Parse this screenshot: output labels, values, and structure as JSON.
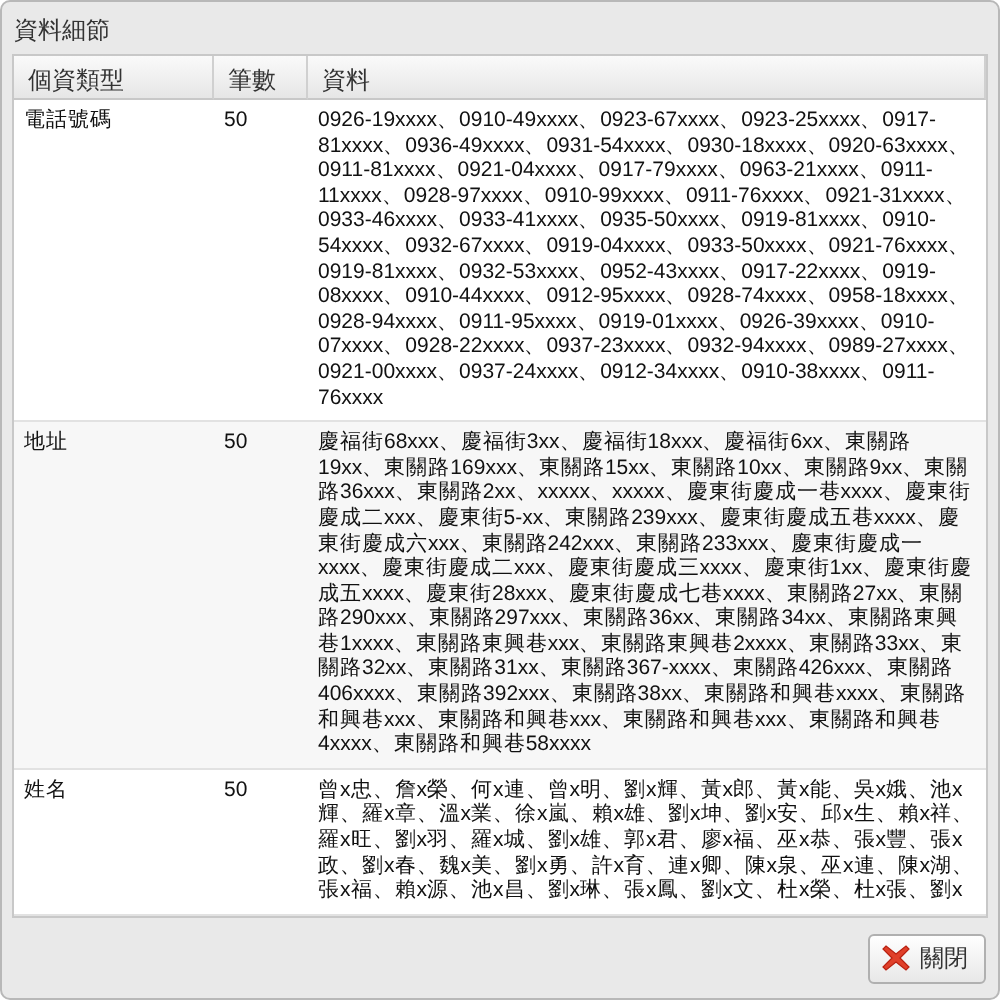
{
  "window": {
    "title": "資料細節"
  },
  "table": {
    "columns": [
      "個資類型",
      "筆數",
      "資料"
    ],
    "rows": [
      {
        "type": "電話號碼",
        "count": "50",
        "data": "0926-19xxxx、0910-49xxxx、0923-67xxxx、0923-25xxxx、0917-81xxxx、0936-49xxxx、0931-54xxxx、0930-18xxxx、0920-63xxxx、0911-81xxxx、0921-04xxxx、0917-79xxxx、0963-21xxxx、0911-11xxxx、0928-97xxxx、0910-99xxxx、0911-76xxxx、0921-31xxxx、0933-46xxxx、0933-41xxxx、0935-50xxxx、0919-81xxxx、0910-54xxxx、0932-67xxxx、0919-04xxxx、0933-50xxxx、0921-76xxxx、0919-81xxxx、0932-53xxxx、0952-43xxxx、0917-22xxxx、0919-08xxxx、0910-44xxxx、0912-95xxxx、0928-74xxxx、0958-18xxxx、0928-94xxxx、0911-95xxxx、0919-01xxxx、0926-39xxxx、0910-07xxxx、0928-22xxxx、0937-23xxxx、0932-94xxxx、0989-27xxxx、0921-00xxxx、0937-24xxxx、0912-34xxxx、0910-38xxxx、0911-76xxxx"
      },
      {
        "type": "地址",
        "count": "50",
        "data": "慶福街68xxx、慶福街3xx、慶福街18xxx、慶福街6xx、東關路19xx、東關路169xxx、東關路15xx、東關路10xx、東關路9xx、東關路36xxx、東關路2xx、xxxxx、xxxxx、慶東街慶成一巷xxxx、慶東街慶成二xxx、慶東街5-xx、東關路239xxx、慶東街慶成五巷xxxx、慶東街慶成六xxx、東關路242xxx、東關路233xxx、慶東街慶成一xxxx、慶東街慶成二xxx、慶東街慶成三xxxx、慶東街1xx、慶東街慶成五xxxx、慶東街28xxx、慶東街慶成七巷xxxx、東關路27xx、東關路290xxx、東關路297xxx、東關路36xx、東關路34xx、東關路東興巷1xxxx、東關路東興巷xxx、東關路東興巷2xxxx、東關路33xx、東關路32xx、東關路31xx、東關路367-xxxx、東關路426xxx、東關路406xxxx、東關路392xxx、東關路38xx、東關路和興巷xxxx、東關路和興巷xxx、東關路和興巷xxx、東關路和興巷xxx、東關路和興巷4xxxx、東關路和興巷58xxxx"
      },
      {
        "type": "姓名",
        "count": "50",
        "data": "曾x忠、詹x榮、何x連、曾x明、劉x輝、黃x郎、黃x能、吳x娥、池x輝、羅x章、溫x業、徐x嵐、賴x雄、劉x坤、劉x安、邱x生、賴x祥、羅x旺、劉x羽、羅x城、劉x雄、郭x君、廖x福、巫x恭、張x豐、張x政、劉x春、魏x美、劉x勇、許x育、連x卿、陳x泉、巫x連、陳x湖、張x福、賴x源、池x昌、劉x琳、張x鳳、劉x文、杜x榮、杜x張、劉x"
      }
    ]
  },
  "buttons": [
    {
      "label": "關閉",
      "kind": "close"
    }
  ]
}
